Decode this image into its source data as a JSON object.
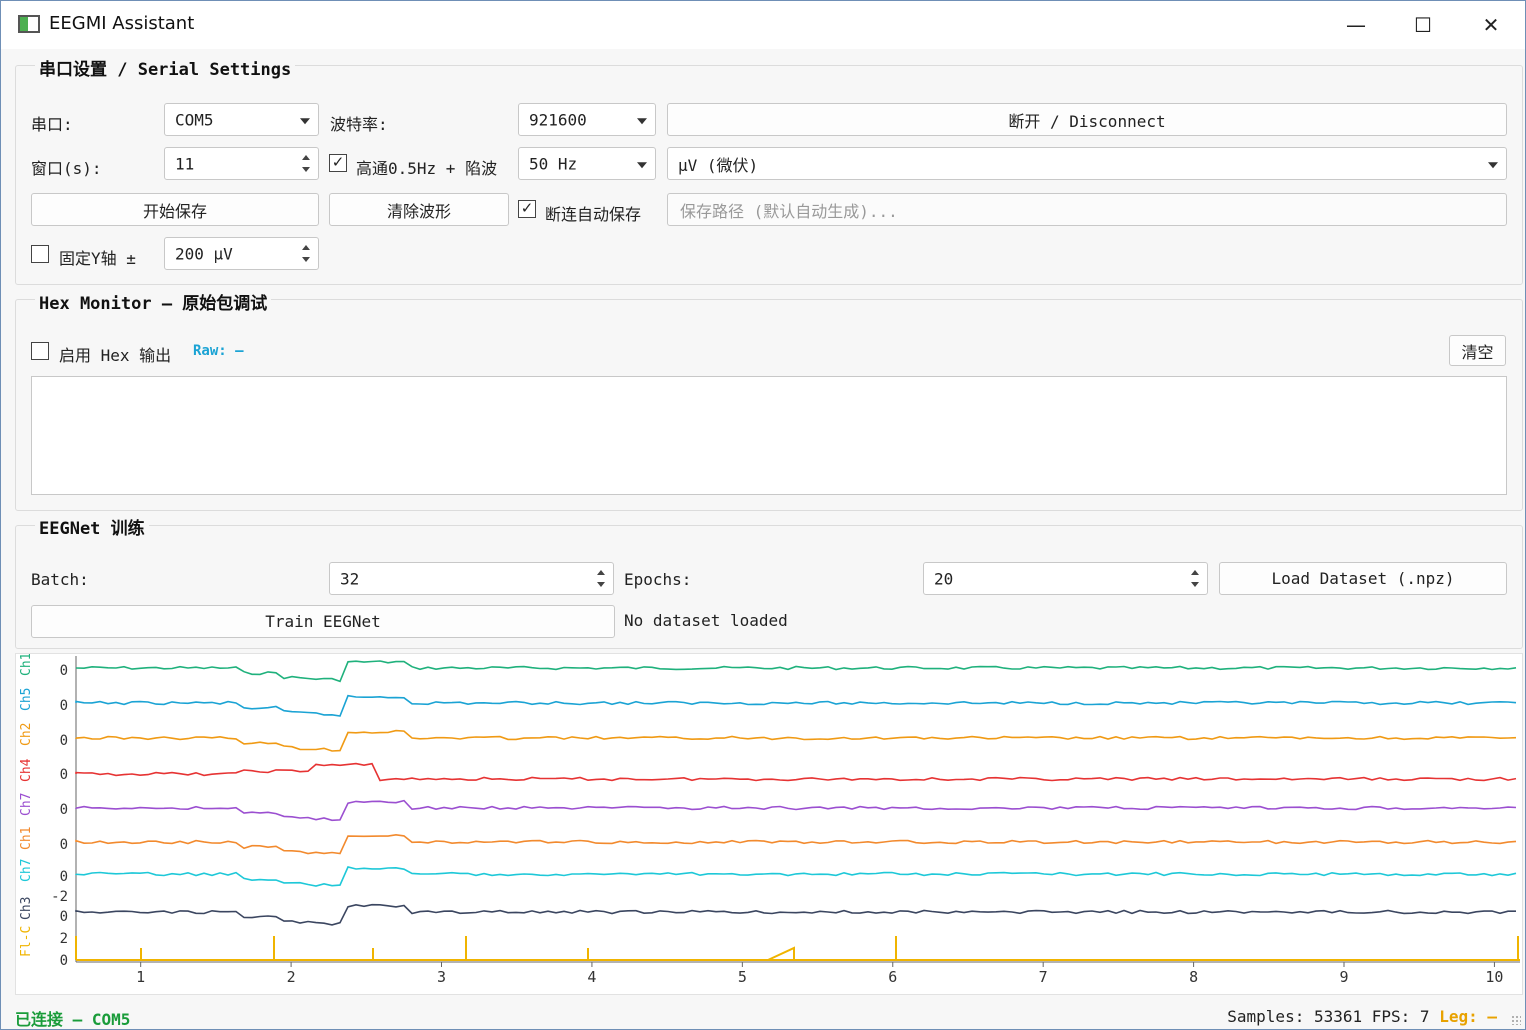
{
  "window": {
    "title": "EEGMI Assistant",
    "controls": {
      "minimize": "—",
      "maximize": "☐",
      "close": "✕"
    }
  },
  "serial": {
    "group_title": "串口设置 / Serial Settings",
    "port_label": "串口:",
    "port_value": "COM5",
    "baud_label": "波特率:",
    "baud_value": "921600",
    "disconnect_label": "断开 / Disconnect",
    "window_label": "窗口(s):",
    "window_value": "11",
    "filter_checked": true,
    "filter_label": "高通0.5Hz + 陷波",
    "notch_value": "50 Hz",
    "unit_value": "μV (微伏)",
    "start_save_label": "开始保存",
    "clear_wave_label": "清除波形",
    "auto_save_checked": true,
    "auto_save_label": "断连自动保存",
    "save_path_placeholder": "保存路径 (默认自动生成)...",
    "fix_y_checked": false,
    "fix_y_label": "固定Y轴 ±",
    "y_range_value": "200 μV"
  },
  "hex": {
    "group_title": "Hex Monitor — 原始包调试",
    "enable_checked": false,
    "enable_label": "启用 Hex 输出",
    "raw_label": "Raw: —",
    "clear_label": "清空",
    "output_text": ""
  },
  "eegnet": {
    "group_title": "EEGNet 训练",
    "batch_label": "Batch:",
    "batch_value": "32",
    "epochs_label": "Epochs:",
    "epochs_value": "20",
    "load_label": "Load Dataset (.npz)",
    "train_label": "Train EEGNet",
    "dataset_status": "No dataset loaded"
  },
  "plot": {
    "channel_labels": [
      "Ch1",
      "Ch5",
      "Ch2",
      "Ch4",
      "Ch7",
      "Ch1",
      "Ch7",
      "Ch3",
      "Fl-C"
    ],
    "y_ticks": [
      "0",
      "0",
      "0",
      "0",
      "0",
      "0",
      "0",
      "-2",
      "0",
      "2",
      "0"
    ],
    "x_ticks": [
      "1",
      "2",
      "3",
      "4",
      "5",
      "6",
      "7",
      "8",
      "9",
      "10"
    ],
    "colors": [
      "#1fb17c",
      "#1ba3d4",
      "#f09a14",
      "#e63333",
      "#9b4fd0",
      "#f28a2e",
      "#1ec8d8",
      "#3b4660",
      "#f0b400"
    ]
  },
  "status": {
    "connection": "已连接 — COM5",
    "samples_label": "Samples: 53361 FPS: 7",
    "leg_label": "Leg: —",
    "colors": {
      "connected": "#1a9c3a",
      "leg": "#e8a200"
    }
  }
}
